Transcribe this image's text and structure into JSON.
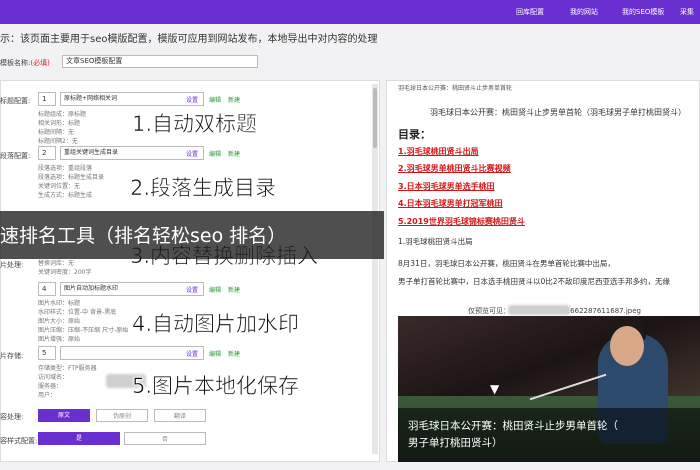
{
  "topbar": {
    "nav": [
      "回库配置",
      "我的网站",
      "我的SEO模板",
      "采集"
    ]
  },
  "hint": "示：该页面主要用于seo模版配置，模版可应用到网站发布，本地导出中对内容的处理",
  "template": {
    "name_label": "模板名称:",
    "required": "(必填)",
    "name_value": "文章SEO模板配置"
  },
  "sections": [
    {
      "label": "标题配置:",
      "num": "1",
      "select": "原标题+网络相关词",
      "set": "设置",
      "edit": "编辑",
      "new": "新建",
      "info": [
        "标题组成：原标题",
        "相关词形：标题",
        "标题间隔：无",
        "标题间隔2：无"
      ]
    },
    {
      "label": "段落配置:",
      "num": "2",
      "select": "重组关键词生成目录",
      "set": "设置",
      "edit": "编辑",
      "new": "新建",
      "info": [
        "段落选项：重组段落",
        "段落选项：标题生成目录",
        "关键词位置：无",
        "生成方式：标题生成"
      ]
    },
    {
      "label": "",
      "num": "",
      "select": "",
      "set": "",
      "edit": "",
      "new": "",
      "info": [
        "替换词库：无",
        "关键词密度：200字"
      ]
    },
    {
      "label": "片处理:",
      "num": "4",
      "select": "图片自动加标题水印",
      "set": "设置",
      "edit": "编辑",
      "new": "新建",
      "info": [
        "图片水印：标题",
        "水印样式：位置-中  背景-黑底",
        "图片大小：原始",
        "图片压缩：压缩-不压缩 尺寸-原始",
        "图片增强：原始"
      ]
    },
    {
      "label": "片存储:",
      "num": "5",
      "select": "",
      "set": "设置",
      "edit": "编辑",
      "new": "新建",
      "info": [
        "存储类型：FTP服务器",
        "访问域名：",
        "服务器：",
        "用户："
      ]
    }
  ],
  "features": [
    "1.自动双标题",
    "2.段落生成目录",
    "3.内容替换删除插入",
    "4.自动图片加水印",
    "5.图片本地化保存"
  ],
  "bottom_rows": [
    {
      "label": "容处理:",
      "buttons": [
        "原文",
        "伪原创",
        "翻译"
      ]
    },
    {
      "label": "容样式配置:",
      "buttons": [
        "是",
        "否"
      ]
    }
  ],
  "overlay_text": "速排名工具（排名轻松seo 排名）",
  "preview": {
    "header": "羽毛球日本公开赛：桃田贤斗止步男单首轮",
    "title": "羽毛球日本公开赛：桃田贤斗止步男单首轮（羽毛球男子单打桃田贤斗）",
    "toc_label": "目录：",
    "toc": [
      "1.羽毛球桃田贤斗出局",
      "2.羽毛球男单桃田贤斗比赛视频",
      "3.日本羽毛球男单选手桃田",
      "4.日本羽毛球男单打冠军桃田",
      "5.2019世界羽毛球锦标赛桃田贤斗"
    ],
    "para_heading": "1.羽毛球桃田贤斗出局",
    "para_lines": [
      "8月31日，羽毛球日本公开赛，桃田贤斗在男单首轮比赛中出局，",
      "男子单打首轮比赛中，日本选手桃田贤斗以0比2不敌印度尼西亚选手邦多约，无缘"
    ],
    "source": "仅预览可见：                          ds/2022-09-04/1662287611687.jpeg",
    "caption": [
      "羽毛球日本公开赛：桃田贤斗止步男单首轮（",
      "男子单打桃田贤斗）"
    ]
  }
}
